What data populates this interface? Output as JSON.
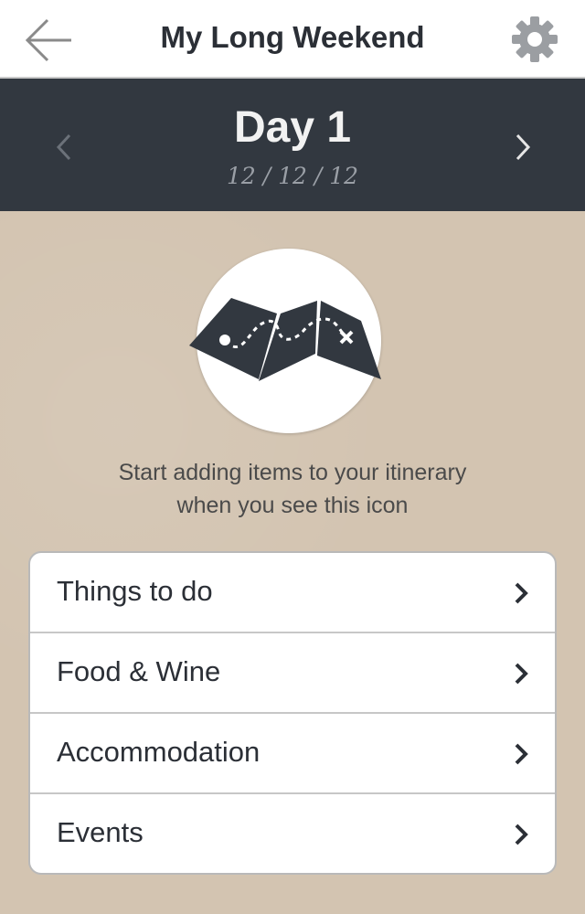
{
  "nav": {
    "title": "My Long Weekend",
    "back_icon": "arrow-left-icon",
    "settings_icon": "gear-icon"
  },
  "day": {
    "title": "Day 1",
    "date": "12 / 12 / 12",
    "prev_icon": "chevron-left-icon",
    "next_icon": "chevron-right-icon"
  },
  "hint": {
    "line1": "Start adding items to your itinerary",
    "line2": "when you see this icon",
    "icon": "treasure-map-icon"
  },
  "menu": {
    "items": [
      {
        "label": "Things to do"
      },
      {
        "label": "Food & Wine"
      },
      {
        "label": "Accommodation"
      },
      {
        "label": "Events"
      }
    ]
  },
  "colors": {
    "header_bg": "#323840",
    "content_bg": "#d3c4b1",
    "text_dark": "#2b2f36"
  }
}
